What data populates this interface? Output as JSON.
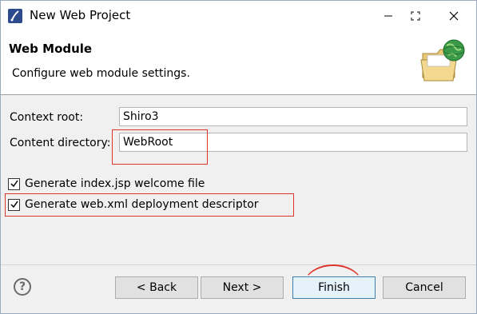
{
  "window": {
    "title": "New Web Project",
    "minimize_icon": "minimize-icon",
    "maximize_icon": "maximize-icon",
    "close_icon": "close-icon"
  },
  "banner": {
    "title": "Web Module",
    "description": "Configure web module settings.",
    "icon": "folder-globe-icon"
  },
  "form": {
    "context_root_label": "Context root:",
    "context_root_value": "Shiro3",
    "content_directory_label": "Content directory:",
    "content_directory_value": "WebRoot",
    "generate_index_label": "Generate index.jsp welcome file",
    "generate_index_checked": true,
    "generate_webxml_label": "Generate web.xml deployment descriptor",
    "generate_webxml_checked": true
  },
  "buttons": {
    "help_icon": "help-icon",
    "help_glyph": "?",
    "back": "< Back",
    "next": "Next >",
    "finish": "Finish",
    "cancel": "Cancel"
  },
  "colors": {
    "annotation_red": "#e0342a",
    "default_button_border": "#3c7fb1"
  }
}
